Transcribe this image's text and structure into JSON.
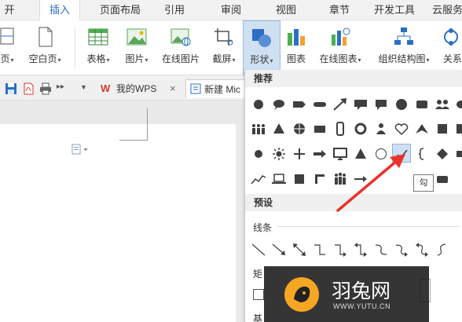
{
  "menubar": {
    "items": [
      {
        "label": "开始",
        "active": false
      },
      {
        "label": "插入",
        "active": true
      },
      {
        "label": "页面布局",
        "active": false
      },
      {
        "label": "引用",
        "active": false
      },
      {
        "label": "审阅",
        "active": false
      },
      {
        "label": "视图",
        "active": false
      },
      {
        "label": "章节",
        "active": false
      },
      {
        "label": "开发工具",
        "active": false
      },
      {
        "label": "云服务",
        "active": false
      }
    ]
  },
  "ribbon": {
    "buttons": [
      {
        "label": "页",
        "icon": "page-break-icon",
        "has_caret": true
      },
      {
        "label": "空白页",
        "icon": "blank-page-icon",
        "has_caret": true
      },
      {
        "label": "表格",
        "icon": "table-icon",
        "has_caret": true
      },
      {
        "label": "图片",
        "icon": "picture-icon",
        "has_caret": true
      },
      {
        "label": "在线图片",
        "icon": "online-picture-icon",
        "has_caret": false
      },
      {
        "label": "截屏",
        "icon": "screenshot-icon",
        "has_caret": true
      },
      {
        "label": "形状",
        "icon": "shapes-icon",
        "has_caret": true
      },
      {
        "label": "图表",
        "icon": "chart-icon",
        "has_caret": false
      },
      {
        "label": "在线图表",
        "icon": "online-chart-icon",
        "has_caret": true
      },
      {
        "label": "组织结构图",
        "icon": "org-chart-icon",
        "has_caret": true
      },
      {
        "label": "关系",
        "icon": "relation-icon",
        "has_caret": false
      }
    ],
    "caret": "▾"
  },
  "quickbar": {
    "tabs": [
      {
        "label": "我的WPS",
        "close": "×"
      },
      {
        "label": "新建 Mic",
        "close": ""
      }
    ],
    "more": "▸▸",
    "dropdown_arrow": "▼"
  },
  "shapes_panel": {
    "sections": {
      "recommended": "推荐",
      "preset": "预设",
      "lines": "线条",
      "rect_partial": "矩",
      "basic_partial": "基"
    },
    "tooltip": "勾"
  },
  "watermark": {
    "title": "羽兔网",
    "url": "WWW.YUTU.CN"
  },
  "colors": {
    "accent": "#2b6fc4",
    "selected": "#cfe0f3",
    "arrow": "#e8322b",
    "shape_fill": "#3f3f3f"
  }
}
